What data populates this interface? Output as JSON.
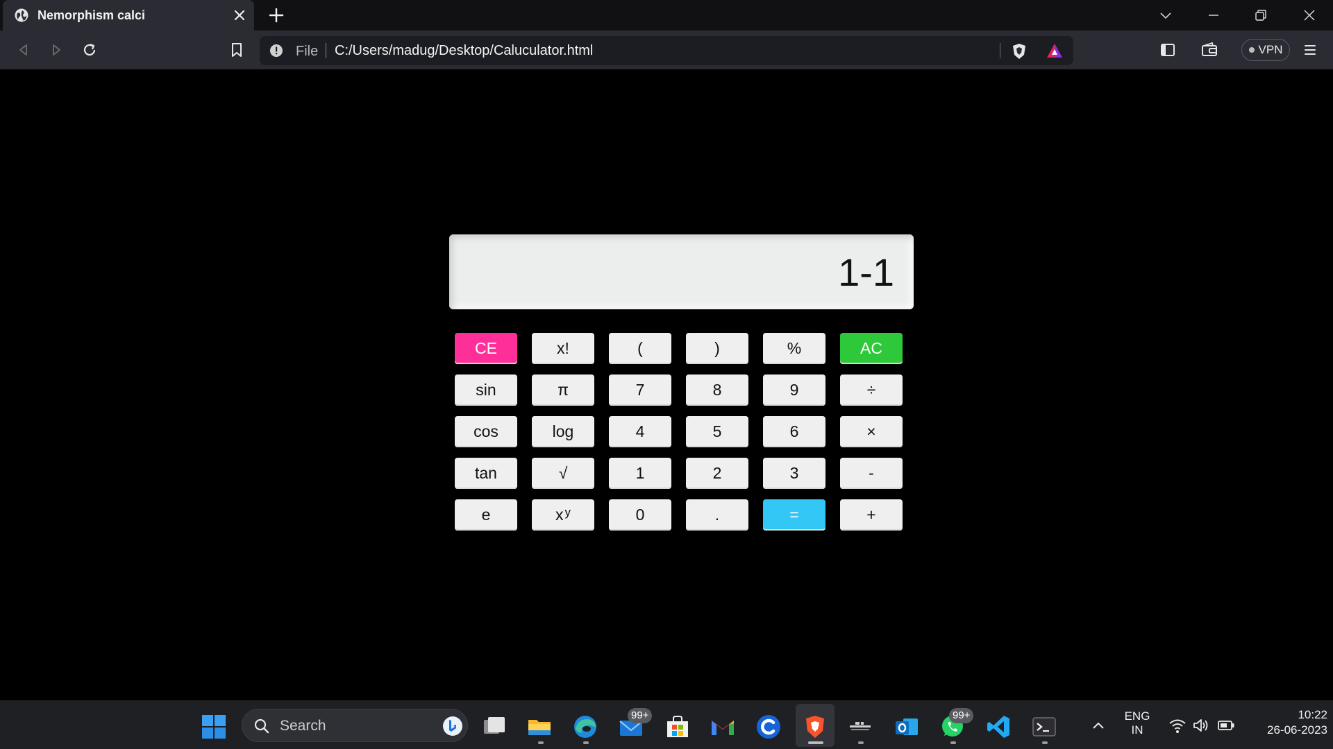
{
  "browser": {
    "tab_title": "Nemorphism calci",
    "url_scheme": "File",
    "url": "C:/Users/madug/Desktop/Caluculator.html",
    "vpn_label": "VPN"
  },
  "calculator": {
    "display": "1-1",
    "keys": [
      {
        "label": "CE",
        "role": "clear-entry"
      },
      {
        "label": "x!",
        "role": "factorial"
      },
      {
        "label": "(",
        "role": "open-paren"
      },
      {
        "label": ")",
        "role": "close-paren"
      },
      {
        "label": "%",
        "role": "percent"
      },
      {
        "label": "AC",
        "role": "all-clear"
      },
      {
        "label": "sin",
        "role": "sin"
      },
      {
        "label": "π",
        "role": "pi"
      },
      {
        "label": "7",
        "role": "digit-7"
      },
      {
        "label": "8",
        "role": "digit-8"
      },
      {
        "label": "9",
        "role": "digit-9"
      },
      {
        "label": "÷",
        "role": "divide"
      },
      {
        "label": "cos",
        "role": "cos"
      },
      {
        "label": "log",
        "role": "log"
      },
      {
        "label": "4",
        "role": "digit-4"
      },
      {
        "label": "5",
        "role": "digit-5"
      },
      {
        "label": "6",
        "role": "digit-6"
      },
      {
        "label": "×",
        "role": "multiply"
      },
      {
        "label": "tan",
        "role": "tan"
      },
      {
        "label": "√",
        "role": "sqrt"
      },
      {
        "label": "1",
        "role": "digit-1"
      },
      {
        "label": "2",
        "role": "digit-2"
      },
      {
        "label": "3",
        "role": "digit-3"
      },
      {
        "label": "-",
        "role": "subtract"
      },
      {
        "label": "e",
        "role": "euler"
      },
      {
        "label": "x",
        "sup": "y",
        "role": "power"
      },
      {
        "label": "0",
        "role": "digit-0"
      },
      {
        "label": ".",
        "role": "decimal"
      },
      {
        "label": "=",
        "role": "equals"
      },
      {
        "label": "+",
        "role": "add"
      }
    ],
    "colors": {
      "ce": "#ff2f9a",
      "ac": "#2ec83b",
      "equals": "#33c7f5",
      "key": "#efefef"
    }
  },
  "taskbar": {
    "search_placeholder": "Search",
    "mail_badge": "99+",
    "whatsapp_badge": "99+",
    "language": "ENG",
    "region": "IN",
    "time": "10:22",
    "date": "26-06-2023"
  }
}
